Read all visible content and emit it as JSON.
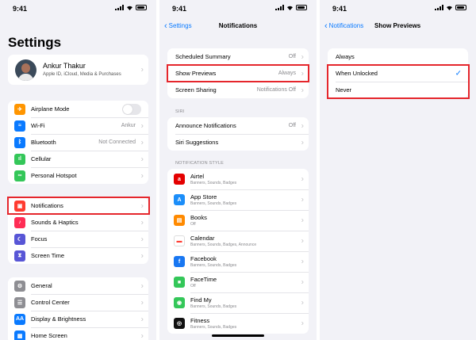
{
  "status": {
    "time": "9:41"
  },
  "panel1": {
    "title": "Settings",
    "profile": {
      "name": "Ankur Thakur",
      "subtitle": "Apple ID, iCloud, Media & Purchases"
    },
    "group1": [
      {
        "label": "Airplane Mode",
        "icon": "airplane-icon",
        "color": "#ff9500",
        "glyph": "✈",
        "toggle": true
      },
      {
        "label": "Wi-Fi",
        "icon": "wifi-icon",
        "color": "#0a7aff",
        "glyph": "≈",
        "value": "Ankur"
      },
      {
        "label": "Bluetooth",
        "icon": "bluetooth-icon",
        "color": "#0a7aff",
        "glyph": "ᛒ",
        "value": "Not Connected"
      },
      {
        "label": "Cellular",
        "icon": "cellular-icon",
        "color": "#34c759",
        "glyph": "ıl"
      },
      {
        "label": "Personal Hotspot",
        "icon": "hotspot-icon",
        "color": "#34c759",
        "glyph": "∞"
      }
    ],
    "group2": [
      {
        "label": "Notifications",
        "icon": "notifications-icon",
        "color": "#ff3b30",
        "glyph": "▣"
      },
      {
        "label": "Sounds & Haptics",
        "icon": "sounds-icon",
        "color": "#ff2d55",
        "glyph": "♪"
      },
      {
        "label": "Focus",
        "icon": "focus-icon",
        "color": "#5856d6",
        "glyph": "☾"
      },
      {
        "label": "Screen Time",
        "icon": "screen-time-icon",
        "color": "#5856d6",
        "glyph": "⧗"
      }
    ],
    "group3": [
      {
        "label": "General",
        "icon": "gear-icon",
        "color": "#8e8e93",
        "glyph": "⚙"
      },
      {
        "label": "Control Center",
        "icon": "control-center-icon",
        "color": "#8e8e93",
        "glyph": "☰"
      },
      {
        "label": "Display & Brightness",
        "icon": "display-icon",
        "color": "#0a7aff",
        "glyph": "AA"
      },
      {
        "label": "Home Screen",
        "icon": "home-screen-icon",
        "color": "#0a7aff",
        "glyph": "▦"
      }
    ]
  },
  "panel2": {
    "back_label": "Settings",
    "title": "Notifications",
    "top_rows": [
      {
        "label": "Scheduled Summary",
        "value": "Off"
      },
      {
        "label": "Show Previews",
        "value": "Always"
      },
      {
        "label": "Screen Sharing",
        "value": "Notifications Off"
      }
    ],
    "siri_header": "SIRI",
    "siri_rows": [
      {
        "label": "Announce Notifications",
        "value": "Off"
      },
      {
        "label": "Siri Suggestions",
        "value": ""
      }
    ],
    "style_header": "NOTIFICATION STYLE",
    "apps": [
      {
        "label": "Airtel",
        "sub": "Banners, Sounds, Badges",
        "icon": "airtel-icon",
        "color": "#e40000",
        "glyph": "a"
      },
      {
        "label": "App Store",
        "sub": "Banners, Sounds, Badges",
        "icon": "app-store-icon",
        "color": "#1c8ef9",
        "glyph": "A"
      },
      {
        "label": "Books",
        "sub": "Off",
        "icon": "books-icon",
        "color": "#ff8a00",
        "glyph": "▤"
      },
      {
        "label": "Calendar",
        "sub": "Banners, Sounds, Badges, Announce",
        "icon": "calendar-icon",
        "color": "#ffffff",
        "glyph": "▬"
      },
      {
        "label": "Facebook",
        "sub": "Banners, Sounds, Badges",
        "icon": "facebook-icon",
        "color": "#1877f2",
        "glyph": "f"
      },
      {
        "label": "FaceTime",
        "sub": "Off",
        "icon": "facetime-icon",
        "color": "#34c759",
        "glyph": "■"
      },
      {
        "label": "Find My",
        "sub": "Banners, Sounds, Badges",
        "icon": "find-my-icon",
        "color": "#34c759",
        "glyph": "◉"
      },
      {
        "label": "Fitness",
        "sub": "Banners, Sounds, Badges",
        "icon": "fitness-icon",
        "color": "#111111",
        "glyph": "◎"
      }
    ]
  },
  "panel3": {
    "back_label": "Notifications",
    "title": "Show Previews",
    "options": [
      {
        "label": "Always",
        "checked": false
      },
      {
        "label": "When Unlocked",
        "checked": true
      },
      {
        "label": "Never",
        "checked": false
      }
    ]
  },
  "colors": {
    "accent": "#0a7aff",
    "highlight": "#e5262c"
  }
}
